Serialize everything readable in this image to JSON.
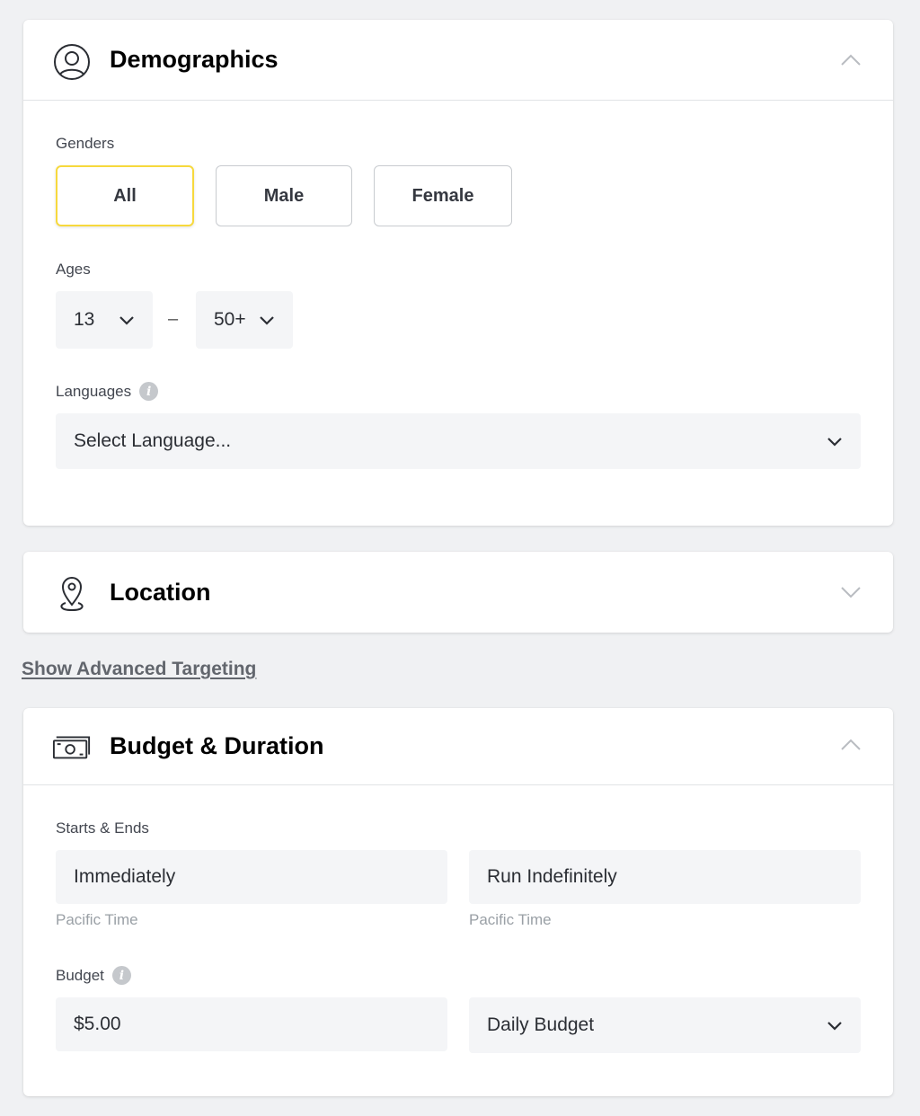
{
  "demographics": {
    "title": "Demographics",
    "icon": "user-circle-icon",
    "expanded": true,
    "genders": {
      "label": "Genders",
      "options": [
        "All",
        "Male",
        "Female"
      ],
      "selected": "All"
    },
    "ages": {
      "label": "Ages",
      "min": "13",
      "separator": "–",
      "max": "50+"
    },
    "languages": {
      "label": "Languages",
      "placeholder": "Select Language..."
    }
  },
  "location": {
    "title": "Location",
    "icon": "map-pin-icon",
    "expanded": false
  },
  "advanced_link": "Show Advanced Targeting",
  "budget_duration": {
    "title": "Budget & Duration",
    "icon": "banknote-icon",
    "expanded": true,
    "starts_ends": {
      "label": "Starts & Ends",
      "start_value": "Immediately",
      "end_value": "Run Indefinitely",
      "start_note": "Pacific Time",
      "end_note": "Pacific Time"
    },
    "budget": {
      "label": "Budget",
      "amount": "$5.00",
      "type": "Daily Budget"
    }
  },
  "colors": {
    "page_bg": "#f0f1f3",
    "selected_border": "#f7d93d",
    "field_bg": "#f4f5f7"
  }
}
